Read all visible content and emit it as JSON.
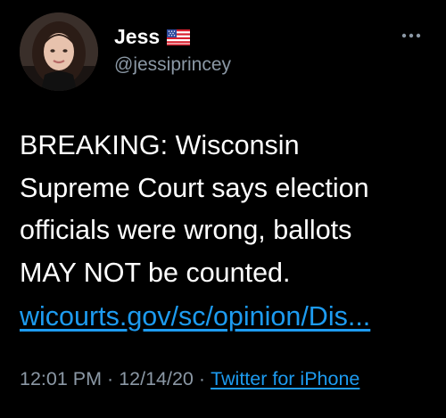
{
  "author": {
    "display_name": "Jess",
    "handle": "@jessiprincey",
    "flag_icon": "us-flag-icon",
    "avatar_icon": "profile-photo"
  },
  "menu": {
    "more_icon": "ellipsis-icon"
  },
  "tweet": {
    "text": "BREAKING: Wisconsin\nSupreme Court says election\nofficials were wrong, ballots\nMAY NOT be counted.",
    "link_text": "wicourts.gov/sc/opinion/Dis..."
  },
  "meta": {
    "time": "12:01 PM",
    "separator": "·",
    "date": "12/14/20",
    "source": "Twitter for iPhone"
  },
  "colors": {
    "background": "#000000",
    "text": "#ffffff",
    "secondary": "#8b98a5",
    "link": "#1d9bf0"
  }
}
